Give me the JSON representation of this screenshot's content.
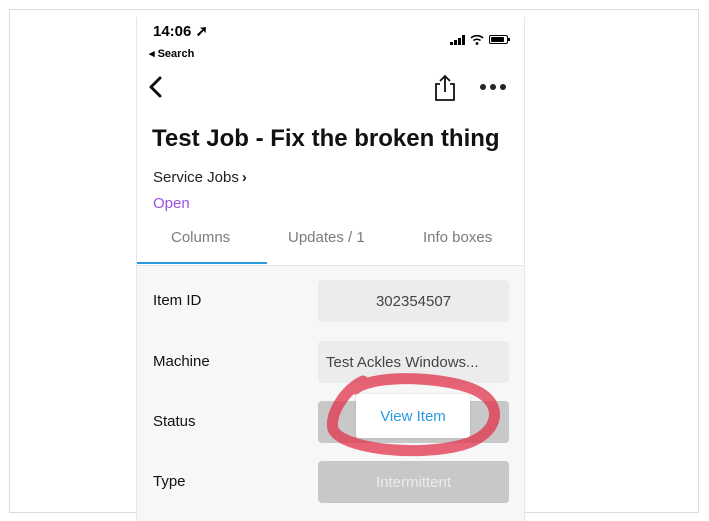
{
  "status_bar": {
    "time": "14:06",
    "back_label": "Search"
  },
  "nav": {
    "back_icon": "chevron-left-icon",
    "share_icon": "share-icon",
    "more_icon": "more-icon"
  },
  "item": {
    "title": "Test Job - Fix the broken thing",
    "board": "Service Jobs",
    "group": "Open"
  },
  "tabs": [
    {
      "label": "Columns",
      "active": true
    },
    {
      "label": "Updates / 1",
      "active": false
    },
    {
      "label": "Info boxes",
      "active": false
    }
  ],
  "fields": [
    {
      "label": "Item ID",
      "value": "302354507"
    },
    {
      "label": "Machine",
      "value": "Test Ackles Windows..."
    },
    {
      "label": "Status",
      "value": ""
    },
    {
      "label": "Type",
      "value": "Intermittent"
    }
  ],
  "popup": {
    "label": "View Item"
  },
  "colors": {
    "accent": "#2b9ae0",
    "group": "#9b51e0",
    "annotation": "#e0334a"
  }
}
